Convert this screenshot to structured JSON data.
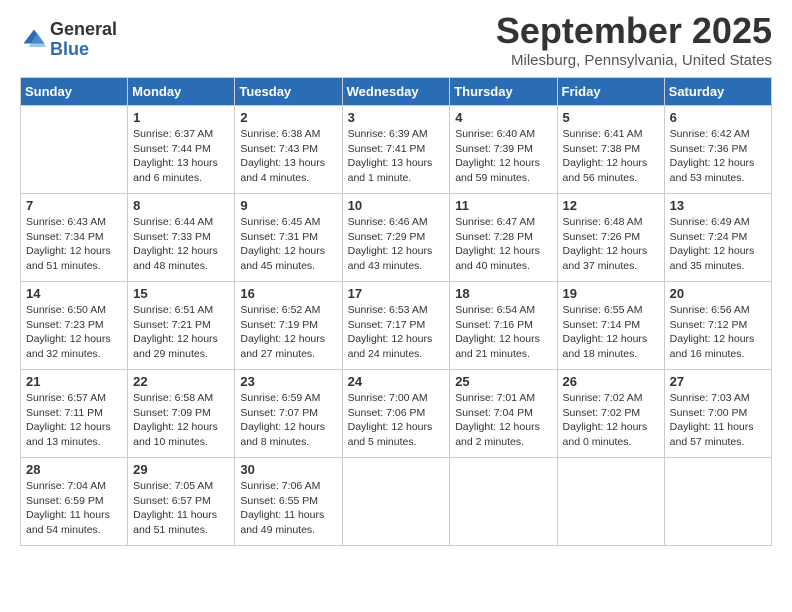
{
  "logo": {
    "general": "General",
    "blue": "Blue"
  },
  "title": "September 2025",
  "location": "Milesburg, Pennsylvania, United States",
  "days_of_week": [
    "Sunday",
    "Monday",
    "Tuesday",
    "Wednesday",
    "Thursday",
    "Friday",
    "Saturday"
  ],
  "weeks": [
    [
      {
        "day": "",
        "info": ""
      },
      {
        "day": "1",
        "info": "Sunrise: 6:37 AM\nSunset: 7:44 PM\nDaylight: 13 hours\nand 6 minutes."
      },
      {
        "day": "2",
        "info": "Sunrise: 6:38 AM\nSunset: 7:43 PM\nDaylight: 13 hours\nand 4 minutes."
      },
      {
        "day": "3",
        "info": "Sunrise: 6:39 AM\nSunset: 7:41 PM\nDaylight: 13 hours\nand 1 minute."
      },
      {
        "day": "4",
        "info": "Sunrise: 6:40 AM\nSunset: 7:39 PM\nDaylight: 12 hours\nand 59 minutes."
      },
      {
        "day": "5",
        "info": "Sunrise: 6:41 AM\nSunset: 7:38 PM\nDaylight: 12 hours\nand 56 minutes."
      },
      {
        "day": "6",
        "info": "Sunrise: 6:42 AM\nSunset: 7:36 PM\nDaylight: 12 hours\nand 53 minutes."
      }
    ],
    [
      {
        "day": "7",
        "info": "Sunrise: 6:43 AM\nSunset: 7:34 PM\nDaylight: 12 hours\nand 51 minutes."
      },
      {
        "day": "8",
        "info": "Sunrise: 6:44 AM\nSunset: 7:33 PM\nDaylight: 12 hours\nand 48 minutes."
      },
      {
        "day": "9",
        "info": "Sunrise: 6:45 AM\nSunset: 7:31 PM\nDaylight: 12 hours\nand 45 minutes."
      },
      {
        "day": "10",
        "info": "Sunrise: 6:46 AM\nSunset: 7:29 PM\nDaylight: 12 hours\nand 43 minutes."
      },
      {
        "day": "11",
        "info": "Sunrise: 6:47 AM\nSunset: 7:28 PM\nDaylight: 12 hours\nand 40 minutes."
      },
      {
        "day": "12",
        "info": "Sunrise: 6:48 AM\nSunset: 7:26 PM\nDaylight: 12 hours\nand 37 minutes."
      },
      {
        "day": "13",
        "info": "Sunrise: 6:49 AM\nSunset: 7:24 PM\nDaylight: 12 hours\nand 35 minutes."
      }
    ],
    [
      {
        "day": "14",
        "info": "Sunrise: 6:50 AM\nSunset: 7:23 PM\nDaylight: 12 hours\nand 32 minutes."
      },
      {
        "day": "15",
        "info": "Sunrise: 6:51 AM\nSunset: 7:21 PM\nDaylight: 12 hours\nand 29 minutes."
      },
      {
        "day": "16",
        "info": "Sunrise: 6:52 AM\nSunset: 7:19 PM\nDaylight: 12 hours\nand 27 minutes."
      },
      {
        "day": "17",
        "info": "Sunrise: 6:53 AM\nSunset: 7:17 PM\nDaylight: 12 hours\nand 24 minutes."
      },
      {
        "day": "18",
        "info": "Sunrise: 6:54 AM\nSunset: 7:16 PM\nDaylight: 12 hours\nand 21 minutes."
      },
      {
        "day": "19",
        "info": "Sunrise: 6:55 AM\nSunset: 7:14 PM\nDaylight: 12 hours\nand 18 minutes."
      },
      {
        "day": "20",
        "info": "Sunrise: 6:56 AM\nSunset: 7:12 PM\nDaylight: 12 hours\nand 16 minutes."
      }
    ],
    [
      {
        "day": "21",
        "info": "Sunrise: 6:57 AM\nSunset: 7:11 PM\nDaylight: 12 hours\nand 13 minutes."
      },
      {
        "day": "22",
        "info": "Sunrise: 6:58 AM\nSunset: 7:09 PM\nDaylight: 12 hours\nand 10 minutes."
      },
      {
        "day": "23",
        "info": "Sunrise: 6:59 AM\nSunset: 7:07 PM\nDaylight: 12 hours\nand 8 minutes."
      },
      {
        "day": "24",
        "info": "Sunrise: 7:00 AM\nSunset: 7:06 PM\nDaylight: 12 hours\nand 5 minutes."
      },
      {
        "day": "25",
        "info": "Sunrise: 7:01 AM\nSunset: 7:04 PM\nDaylight: 12 hours\nand 2 minutes."
      },
      {
        "day": "26",
        "info": "Sunrise: 7:02 AM\nSunset: 7:02 PM\nDaylight: 12 hours\nand 0 minutes."
      },
      {
        "day": "27",
        "info": "Sunrise: 7:03 AM\nSunset: 7:00 PM\nDaylight: 11 hours\nand 57 minutes."
      }
    ],
    [
      {
        "day": "28",
        "info": "Sunrise: 7:04 AM\nSunset: 6:59 PM\nDaylight: 11 hours\nand 54 minutes."
      },
      {
        "day": "29",
        "info": "Sunrise: 7:05 AM\nSunset: 6:57 PM\nDaylight: 11 hours\nand 51 minutes."
      },
      {
        "day": "30",
        "info": "Sunrise: 7:06 AM\nSunset: 6:55 PM\nDaylight: 11 hours\nand 49 minutes."
      },
      {
        "day": "",
        "info": ""
      },
      {
        "day": "",
        "info": ""
      },
      {
        "day": "",
        "info": ""
      },
      {
        "day": "",
        "info": ""
      }
    ]
  ]
}
